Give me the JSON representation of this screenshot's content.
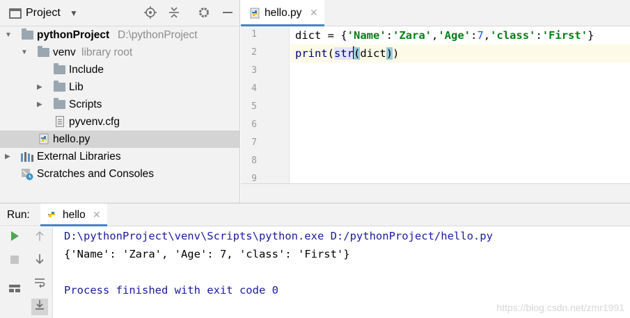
{
  "project_panel": {
    "title": "Project",
    "toolbar_icons": [
      "crosshair-icon",
      "collapse-icon",
      "gear-icon",
      "minimize-icon"
    ],
    "tree": {
      "root_name": "pythonProject",
      "root_path": "D:\\pythonProject",
      "venv_name": "venv",
      "venv_hint": "library root",
      "include": "Include",
      "lib": "Lib",
      "scripts": "Scripts",
      "cfg": "pyvenv.cfg",
      "hello": "hello.py",
      "external": "External Libraries",
      "scratches": "Scratches and Consoles"
    }
  },
  "editor": {
    "tab_label": "hello.py",
    "line_numbers": [
      "1",
      "2",
      "3",
      "4",
      "5",
      "6",
      "7",
      "8",
      "9"
    ],
    "code": {
      "l1_a": "dict = {",
      "l1_k1": "'Name'",
      "l1_c1": ":",
      "l1_v1": "'Zara'",
      "l1_s1": ",",
      "l1_k2": "'Age'",
      "l1_c2": ":",
      "l1_v2": "7",
      "l1_s2": ",",
      "l1_k3": "'class'",
      "l1_c3": ":",
      "l1_v3": "'First'",
      "l1_end": "}",
      "l2_print": "print",
      "l2_open": "(",
      "l2_str": "str",
      "l2_open2": "(",
      "l2_arg": "dict",
      "l2_close2": ")",
      "l2_close": ")"
    }
  },
  "run_panel": {
    "label": "Run:",
    "tab_label": "hello",
    "output": [
      "D:\\pythonProject\\venv\\Scripts\\python.exe D:/pythonProject/hello.py",
      "{'Name': 'Zara', 'Age': 7, 'class': 'First'}",
      "",
      "Process finished with exit code 0"
    ],
    "watermark": "https://blog.csdn.net/zmr1991"
  },
  "colors": {
    "string": "#067d17",
    "number": "#1750eb",
    "builtin": "#000080",
    "console_blue": "#1a1a9c",
    "run_green": "#4fa84f",
    "selection": "#d4d4d4",
    "tab_underline": "#4083c9"
  }
}
